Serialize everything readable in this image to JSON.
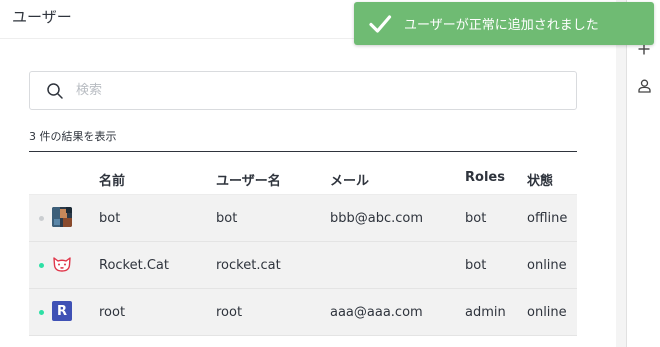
{
  "header": {
    "title": "ユーザー"
  },
  "toast": {
    "message": "ユーザーが正常に追加されました",
    "color": "#6fbb73"
  },
  "search": {
    "placeholder": "検索",
    "value": ""
  },
  "results": {
    "summary": "3 件の結果を表示"
  },
  "table": {
    "columns": [
      "名前",
      "ユーザー名",
      "メール",
      "Roles",
      "状態"
    ],
    "rows": [
      {
        "name": "bot",
        "username": "bot",
        "email": "bbb@abc.com",
        "roles": "bot",
        "status": "offline",
        "status_color": "#cbced1",
        "avatar": "photo-avatar"
      },
      {
        "name": "Rocket.Cat",
        "username": "rocket.cat",
        "email": "",
        "roles": "bot",
        "status": "online",
        "status_color": "#2de0a5",
        "avatar": "cat-avatar"
      },
      {
        "name": "root",
        "username": "root",
        "email": "aaa@aaa.com",
        "roles": "admin",
        "status": "online",
        "status_color": "#2de0a5",
        "avatar": "letter-avatar",
        "avatar_letter": "R"
      }
    ]
  },
  "rail": {
    "icons": [
      "send-icon",
      "plus-icon",
      "user-icon"
    ]
  },
  "colors": {
    "offline": "#cbced1",
    "online": "#2de0a5",
    "avatar_letter_bg": "#3f51b5"
  }
}
